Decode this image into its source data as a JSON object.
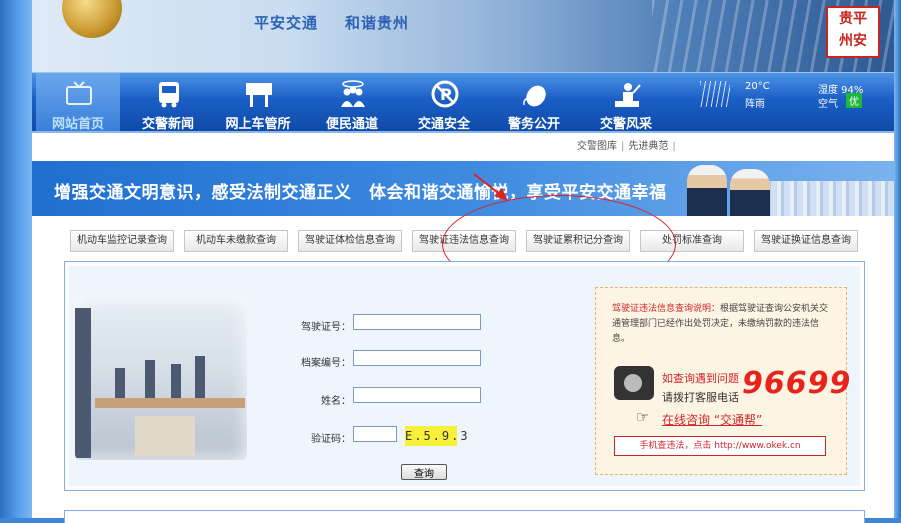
{
  "header": {
    "slogan_a": "平安交通",
    "slogan_b": "和谐贵州",
    "seal_line1": "贵平",
    "seal_line2": "州安"
  },
  "nav": {
    "items": [
      {
        "label": "网站首页",
        "icon": "tv-icon"
      },
      {
        "label": "交警新闻",
        "icon": "bus-icon"
      },
      {
        "label": "网上车管所",
        "icon": "sign-icon"
      },
      {
        "label": "便民通道",
        "icon": "people-icon"
      },
      {
        "label": "交通安全",
        "icon": "no-parking-icon"
      },
      {
        "label": "警务公开",
        "icon": "mouse-icon"
      },
      {
        "label": "交警风采",
        "icon": "officer-icon"
      }
    ],
    "active_index": 0
  },
  "weather": {
    "temp": "20°C",
    "condition": "阵雨",
    "humidity": "湿度 94%",
    "air_label": "空气",
    "air_quality": "优",
    "air_quality_color": "#20b83a"
  },
  "sublinks": [
    "交警图库",
    "先进典范"
  ],
  "slogan_banner": {
    "text": "增强交通文明意识，感受法制交通正义　体会和谐交通愉悦，享受平安交通幸福"
  },
  "tabs": [
    "机动车监控记录查询",
    "机动车未缴款查询",
    "驾驶证体检信息查询",
    "驾驶证违法信息查询",
    "驾驶证累积记分查询",
    "处罚标准查询",
    "驾驶证换证信息查询"
  ],
  "form": {
    "license_label": "驾驶证号：",
    "file_label": "档案编号：",
    "name_label": "姓名：",
    "captcha_label": "验证码：",
    "captcha_code": "E.5.9.3",
    "license_value": "",
    "file_value": "",
    "name_value": "",
    "captcha_value": "",
    "submit_label": "查询"
  },
  "info": {
    "title_red": "驾驶证违法信息查询说明：",
    "title_rest": "根据驾驶证查询公安机关交通管理部门已经作出处罚决定，未缴纳罚款的违法信息。",
    "line1": "如查询遇到问题",
    "line2": "请拨打客服电话",
    "hotline": "96699",
    "consult": "在线咨询 “交通帮”",
    "mobile": "手机查违法，点击 http://www.okek.cn"
  },
  "colors": {
    "nav_blue": "#1b5fc6",
    "accent_red": "#d0262a"
  }
}
